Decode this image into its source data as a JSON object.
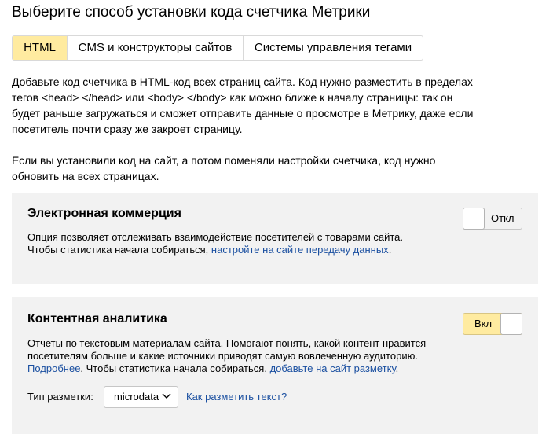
{
  "page": {
    "title": "Выберите способ установки кода счетчика Метрики"
  },
  "tabs": [
    {
      "label": "HTML",
      "active": true
    },
    {
      "label": "CMS и конструкторы сайтов",
      "active": false
    },
    {
      "label": "Системы управления тегами",
      "active": false
    }
  ],
  "intro": {
    "paragraph_1": "Добавьте код счетчика в HTML-код всех страниц сайта. Код нужно разместить в пределах тегов <head> </head> или <body> </body> как можно ближе к началу страницы: так он будет раньше загружаться и сможет отправить данные о просмотре в Метрику, даже если посетитель почти сразу же закроет страницу.",
    "paragraph_2": "Если вы установили код на сайт, а потом поменяли настройки счетчика, код нужно обновить на всех страницах."
  },
  "ecommerce": {
    "title": "Электронная коммерция",
    "desc_line_1": "Опция позволяет отслеживать взаимодействие посетителей с товарами сайта.",
    "desc_line_2_prefix": "Чтобы статистика начала собираться, ",
    "desc_link": "настройте на сайте передачу данных",
    "desc_suffix": ".",
    "toggle_label": "Откл",
    "enabled": false
  },
  "content_analytics": {
    "title": "Контентная аналитика",
    "desc_text": "Отчеты по текстовым материалам сайта. Помогают понять, какой контент нравится посетителям больше и какие источники приводят самую вовлеченную аудиторию.",
    "more_link": "Подробнее",
    "desc_middle": ". Чтобы статистика начала собираться, ",
    "markup_link": "добавьте на сайт разметку",
    "desc_suffix": ".",
    "toggle_label": "Вкл",
    "enabled": true,
    "markup_type_label": "Тип разметки:",
    "markup_type_value": "microdata",
    "markup_help_link": "Как разметить текст?"
  },
  "colors": {
    "accent_yellow": "#ffeba0",
    "link_blue": "#1a4fa0",
    "card_background": "#f2f2f2",
    "border_gray": "#d9d9d9"
  },
  "icons": {
    "select_chevron": "chevron-down-icon"
  }
}
